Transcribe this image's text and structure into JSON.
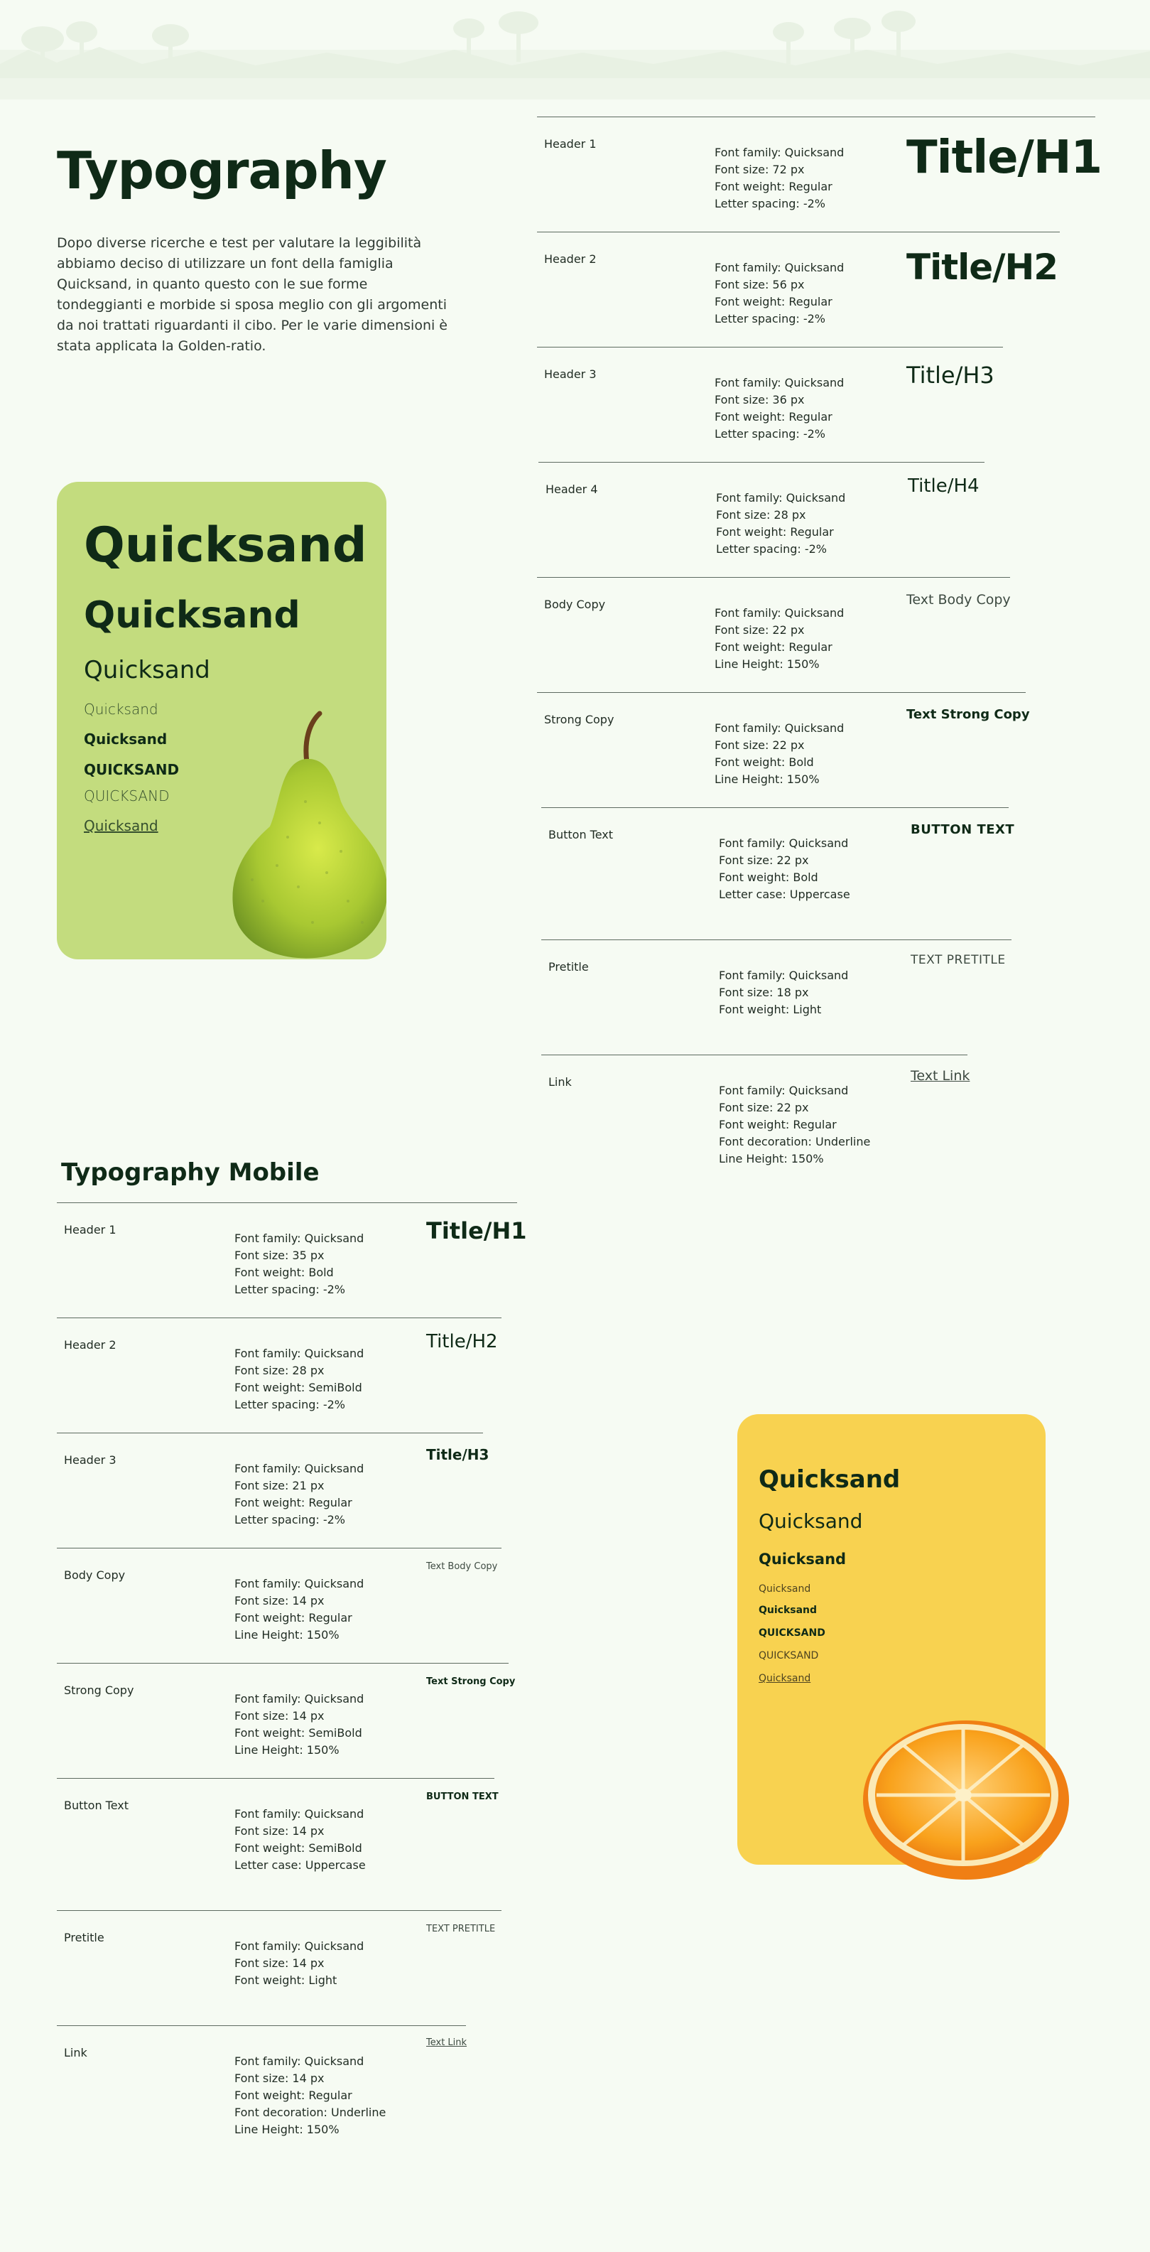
{
  "page_title": "Typography",
  "intro": "Dopo diverse ricerche e test per valutare la leggibilità abbiamo deciso di utilizzare un font della famiglia Quicksand, in quanto questo con le sue forme tondeggianti e morbide si sposa meglio con gli argomenti da noi trattati riguardanti il cibo. Per le varie dimensioni è stata applicata la Golden-ratio.",
  "desktop_rows": [
    {
      "label": "Header 1",
      "specs": [
        "Font family: Quicksand",
        "Font size: 72 px",
        "Font weight: Regular",
        "Letter spacing: -2%"
      ],
      "sample": "Title/H1"
    },
    {
      "label": "Header 2",
      "specs": [
        "Font family: Quicksand",
        "Font size: 56 px",
        "Font weight: Regular",
        "Letter spacing: -2%"
      ],
      "sample": "Title/H2"
    },
    {
      "label": "Header 3",
      "specs": [
        "Font family: Quicksand",
        "Font size: 36 px",
        "Font weight: Regular",
        "Letter spacing: -2%"
      ],
      "sample": "Title/H3"
    },
    {
      "label": "Header 4",
      "specs": [
        "Font family: Quicksand",
        "Font size: 28 px",
        "Font weight: Regular",
        "Letter spacing: -2%"
      ],
      "sample": "Title/H4"
    },
    {
      "label": "Body Copy",
      "specs": [
        "Font family: Quicksand",
        "Font size: 22 px",
        "Font weight: Regular",
        "Line Height: 150%"
      ],
      "sample": "Text Body Copy"
    },
    {
      "label": "Strong Copy",
      "specs": [
        "Font family: Quicksand",
        "Font size: 22 px",
        "Font weight: Bold",
        "Line Height: 150%"
      ],
      "sample": "Text Strong Copy"
    },
    {
      "label": "Button Text",
      "specs": [
        "Font family: Quicksand",
        "Font size: 22 px",
        "Font weight: Bold",
        "Letter case: Uppercase"
      ],
      "sample": "BUTTON TEXT"
    },
    {
      "label": "Pretitle",
      "specs": [
        "Font family: Quicksand",
        "Font size: 18 px",
        "Font weight: Light"
      ],
      "sample": "TEXT PRETITLE"
    },
    {
      "label": "Link",
      "specs": [
        "Font family: Quicksand",
        "Font size: 22 px",
        "Font weight: Regular",
        "Font decoration: Underline",
        "Line Height: 150%"
      ],
      "sample": "Text Link"
    }
  ],
  "mobile_title": "Typography Mobile",
  "mobile_rows": [
    {
      "label": "Header 1",
      "specs": [
        "Font family: Quicksand",
        "Font size: 35 px",
        "Font weight: Bold",
        "Letter spacing: -2%"
      ],
      "sample": "Title/H1"
    },
    {
      "label": "Header 2",
      "specs": [
        "Font family: Quicksand",
        "Font size: 28 px",
        "Font weight: SemiBold",
        "Letter spacing: -2%"
      ],
      "sample": "Title/H2"
    },
    {
      "label": "Header 3",
      "specs": [
        "Font family: Quicksand",
        "Font size: 21 px",
        "Font weight: Regular",
        "Letter spacing: -2%"
      ],
      "sample": "Title/H3"
    },
    {
      "label": "Body Copy",
      "specs": [
        "Font family: Quicksand",
        "Font size: 14 px",
        "Font weight: Regular",
        "Line Height: 150%"
      ],
      "sample": "Text Body Copy"
    },
    {
      "label": "Strong Copy",
      "specs": [
        "Font family: Quicksand",
        "Font size: 14 px",
        "Font weight: SemiBold",
        "Line Height: 150%"
      ],
      "sample": "Text Strong Copy"
    },
    {
      "label": "Button Text",
      "specs": [
        "Font family: Quicksand",
        "Font size: 14 px",
        "Font weight: SemiBold",
        "Letter case: Uppercase"
      ],
      "sample": "BUTTON TEXT"
    },
    {
      "label": "Pretitle",
      "specs": [
        "Font family: Quicksand",
        "Font size: 14 px",
        "Font weight: Light"
      ],
      "sample": "TEXT PRETITLE"
    },
    {
      "label": "Link",
      "specs": [
        "Font family: Quicksand",
        "Font size: 14 px",
        "Font weight: Regular",
        "Font decoration: Underline",
        "Line Height: 150%"
      ],
      "sample": "Text Link"
    }
  ],
  "pear_card": {
    "color": "#c3dc7e",
    "samples": [
      "Quicksand",
      "Quicksand",
      "Quicksand",
      "Quicksand",
      "Quicksand",
      "QUICKSAND",
      "QUICKSAND",
      "Quicksand"
    ]
  },
  "orange_card": {
    "color": "#f8d250",
    "samples": [
      "Quicksand",
      "Quicksand",
      "Quicksand",
      "Quicksand",
      "Quicksand",
      "QUICKSAND",
      "QUICKSAND",
      "Quicksand"
    ]
  },
  "colors": {
    "background": "#f6fbf3",
    "text": "#0f2a17",
    "rule": "#5d6a60"
  }
}
